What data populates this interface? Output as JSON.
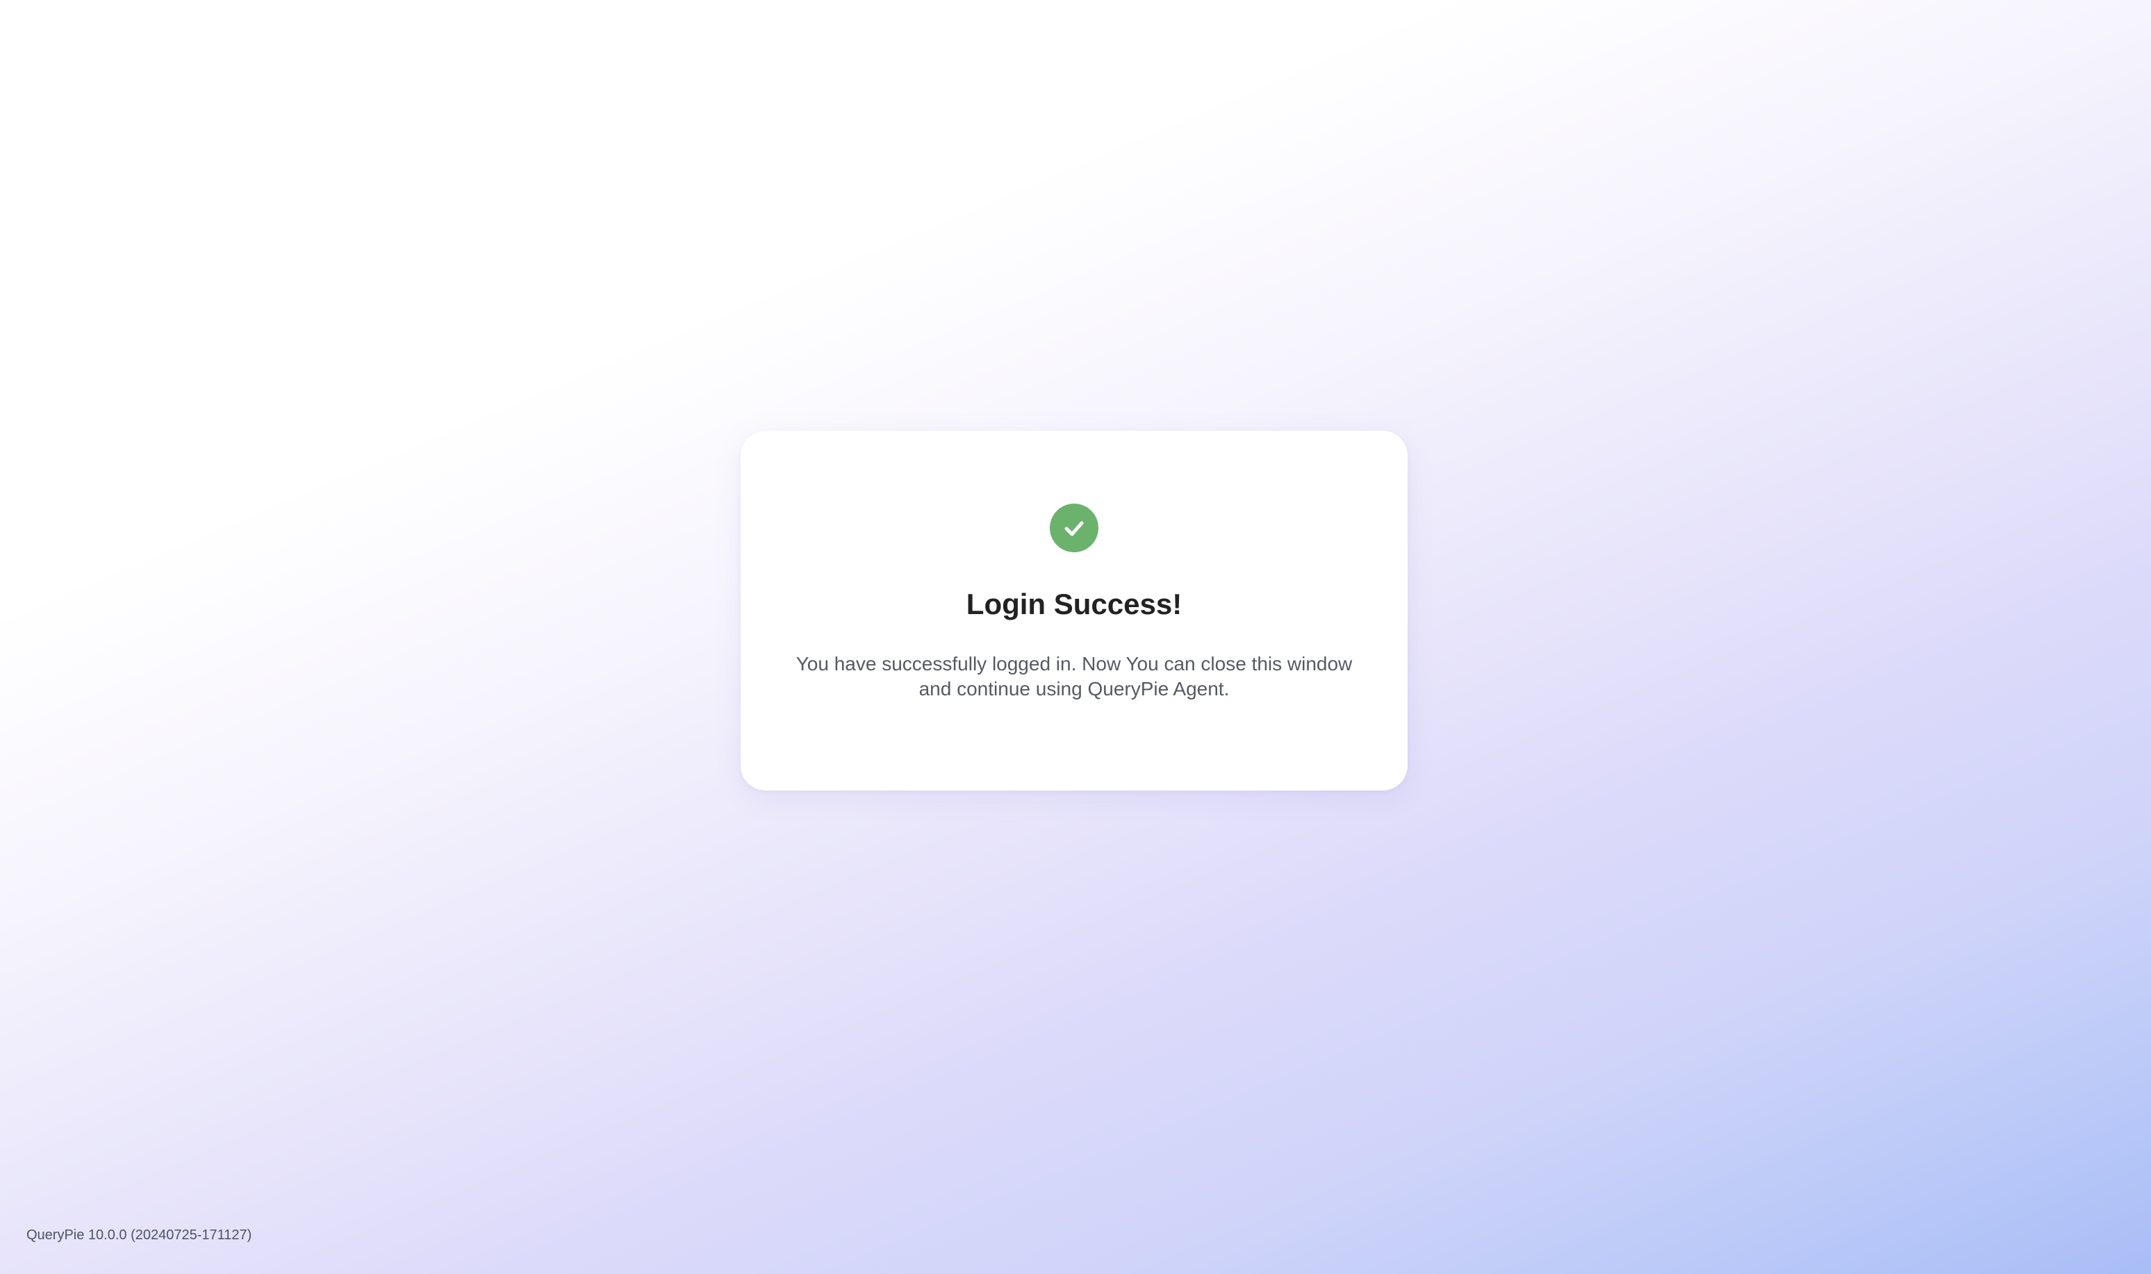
{
  "card": {
    "icon": "check-circle-icon",
    "title": "Login Success!",
    "message_line1": "You have successfully logged in. Now You can close this window",
    "message_line2": "and continue using QueryPie Agent."
  },
  "footer": {
    "version": "QueryPie 10.0.0 (20240725-171127)"
  },
  "colors": {
    "success": "#6bb26d",
    "title": "#222222",
    "body_text": "#555a63",
    "gradient_end": "#a9bdf6"
  }
}
